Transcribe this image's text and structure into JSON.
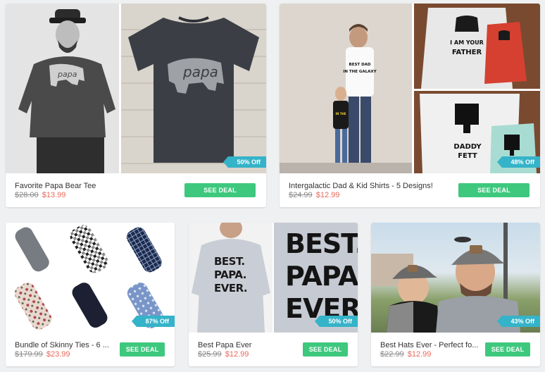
{
  "deals": [
    {
      "title": "Favorite Papa Bear Tee",
      "old_price": "$28.00",
      "new_price": "$13.99",
      "badge": "50% Off",
      "cta": "SEE DEAL",
      "shirt_text": "papa"
    },
    {
      "title": "Intergalactic Dad & Kid Shirts - 5 Designs!",
      "old_price": "$24.99",
      "new_price": "$12.99",
      "badge": "48% Off",
      "cta": "SEE DEAL",
      "dad_text": "BEST DAD IN THE GALAXY",
      "kid_text": "BEST KID IN THE GALAXY",
      "father_text": "I AM YOUR FATHER",
      "fett_text": "DADDY FETT"
    },
    {
      "title": "Bundle of Skinny Ties - 6 ...",
      "old_price": "$179.99",
      "new_price": "$23.99",
      "badge": "87% Off",
      "cta": "SEE DEAL"
    },
    {
      "title": "Best Papa Ever",
      "old_price": "$25.99",
      "new_price": "$12.99",
      "badge": "50% Off",
      "cta": "SEE DEAL",
      "big_lines": [
        "BEST.",
        "PAPA.",
        "EVER"
      ],
      "small_lines": [
        "BEST.",
        "PAPA.",
        "EVER."
      ]
    },
    {
      "title": "Best Hats Ever - Perfect fo...",
      "old_price": "$22.99",
      "new_price": "$12.99",
      "badge": "43% Off",
      "cta": "SEE DEAL"
    }
  ]
}
